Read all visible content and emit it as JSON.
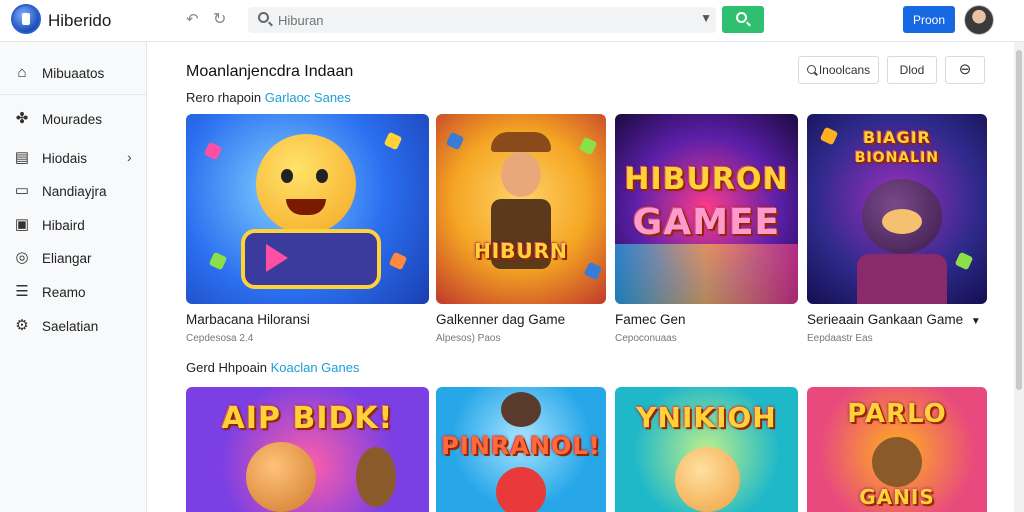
{
  "app": {
    "title": "Hiberido"
  },
  "search": {
    "placeholder": "Hiburan"
  },
  "header": {
    "primary_label": "Proon"
  },
  "sidebar": {
    "items": [
      {
        "label": "Mibuaatos",
        "icon": "home-icon"
      },
      {
        "label": "Mourades",
        "icon": "puzzle-icon"
      },
      {
        "label": "Hiodais",
        "icon": "chart-icon",
        "has_chevron": true
      },
      {
        "label": "Nandiayjra",
        "icon": "document-icon"
      },
      {
        "label": "Hibaird",
        "icon": "board-icon"
      },
      {
        "label": "Eliangar",
        "icon": "target-icon"
      },
      {
        "label": "Reamo",
        "icon": "list-icon"
      },
      {
        "label": "Saelatian",
        "icon": "gear-icon"
      }
    ]
  },
  "main": {
    "title": "Moanlanjencdra Indaan",
    "toolbar": {
      "search_label": "Inoolcans",
      "button2_label": "Dlod",
      "button3_icon": "circle-minus-icon"
    },
    "sections": [
      {
        "title_plain": "Rero rhapoin",
        "title_accent": "Garlaoc Sanes",
        "cards": [
          {
            "title": "Marbacana Hiloransi",
            "subtitle": "Cepdesosa 2.4",
            "thumb_text": "",
            "palette": [
              "#2b6ff0",
              "#ff4fa3",
              "#ffd23a"
            ]
          },
          {
            "title": "Galkenner dag Game",
            "subtitle": "Alpesos) Paos",
            "thumb_text": "HIBURN",
            "palette": [
              "#f5a623",
              "#c0392b",
              "#3a7bd5"
            ]
          },
          {
            "title": "Famec Gen",
            "subtitle": "Cepoconuaas",
            "thumb_text": "HIBURON GAMEE",
            "palette": [
              "#5b1fa8",
              "#ff3b8d",
              "#1ec8ff"
            ]
          },
          {
            "title": "Serieaain Gankaan Game",
            "subtitle": "Eepdaastr Eas",
            "thumb_text": "BIAGIR BIONALIN",
            "palette": [
              "#2d2a8a",
              "#9b2fbd",
              "#ffb020"
            ],
            "has_dropdown": true
          }
        ]
      },
      {
        "title_plain": "Gerd Hhpoain",
        "title_accent": "Koaclan Ganes",
        "cards": [
          {
            "title": "",
            "subtitle": "",
            "thumb_text": "AIP BIDK!",
            "palette": [
              "#7b3fe4",
              "#ff5fa8",
              "#ffcc33"
            ]
          },
          {
            "title": "",
            "subtitle": "",
            "thumb_text": "PINRANOL!",
            "palette": [
              "#27a7e8",
              "#ff6b3d",
              "#ffd23a"
            ]
          },
          {
            "title": "",
            "subtitle": "",
            "thumb_text": "YNIKIOH",
            "palette": [
              "#1fb8c9",
              "#8bd34a",
              "#ffd23a"
            ]
          },
          {
            "title": "",
            "subtitle": "",
            "thumb_text": "PARLO GANIS",
            "palette": [
              "#e84a7d",
              "#ffb020",
              "#33b5e5"
            ]
          }
        ]
      }
    ]
  }
}
